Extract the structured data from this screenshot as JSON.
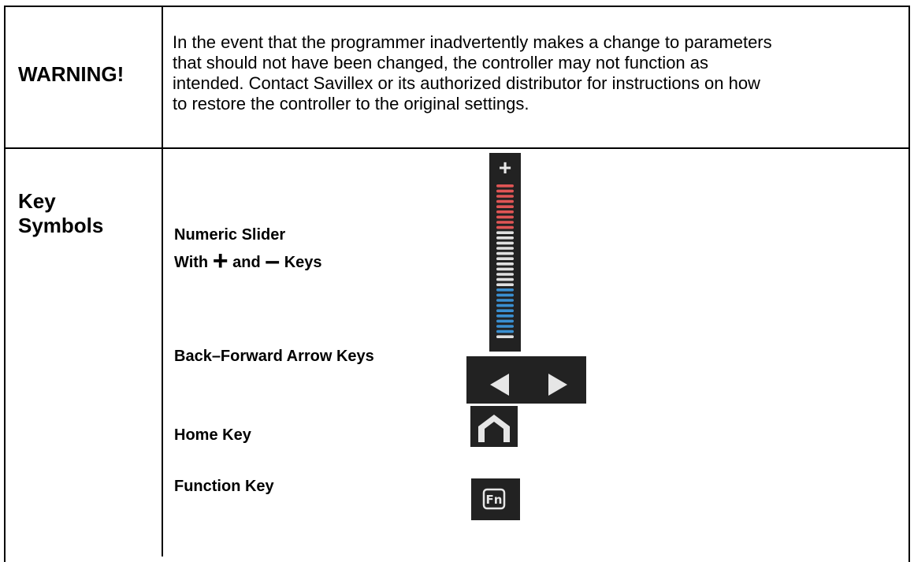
{
  "warning": {
    "label": "WARNING!",
    "lines": [
      "In the event that the programmer inadvertently makes a change to parameters",
      "that should not have been changed, the controller may not function as",
      "intended.  Contact Savillex or its authorized distributor for instructions on how",
      "to restore the controller to the original settings."
    ]
  },
  "key_symbols": {
    "label_line1": "Key",
    "label_line2": "Symbols",
    "numeric_slider": {
      "line1": "Numeric Slider",
      "with_word": "With",
      "plus_sign": "+",
      "and_word": "and",
      "minus_sign": "–",
      "keys_word": "Keys",
      "plus_glyph": "+"
    },
    "back_forward_label": "Back–Forward Arrow Keys",
    "home_label": "Home Key",
    "function_label": "Function Key",
    "function_icon_text": "Fn"
  },
  "colors": {
    "key_background": "#222222",
    "slider_top": "#e05555",
    "slider_middle": "#e0e0e0",
    "slider_bottom": "#3a8fd0",
    "icon_light": "#e6e6e6"
  },
  "icons": [
    "plus-icon",
    "slider-bar-icon",
    "left-arrow-icon",
    "right-arrow-icon",
    "home-icon",
    "fn-key-icon"
  ]
}
